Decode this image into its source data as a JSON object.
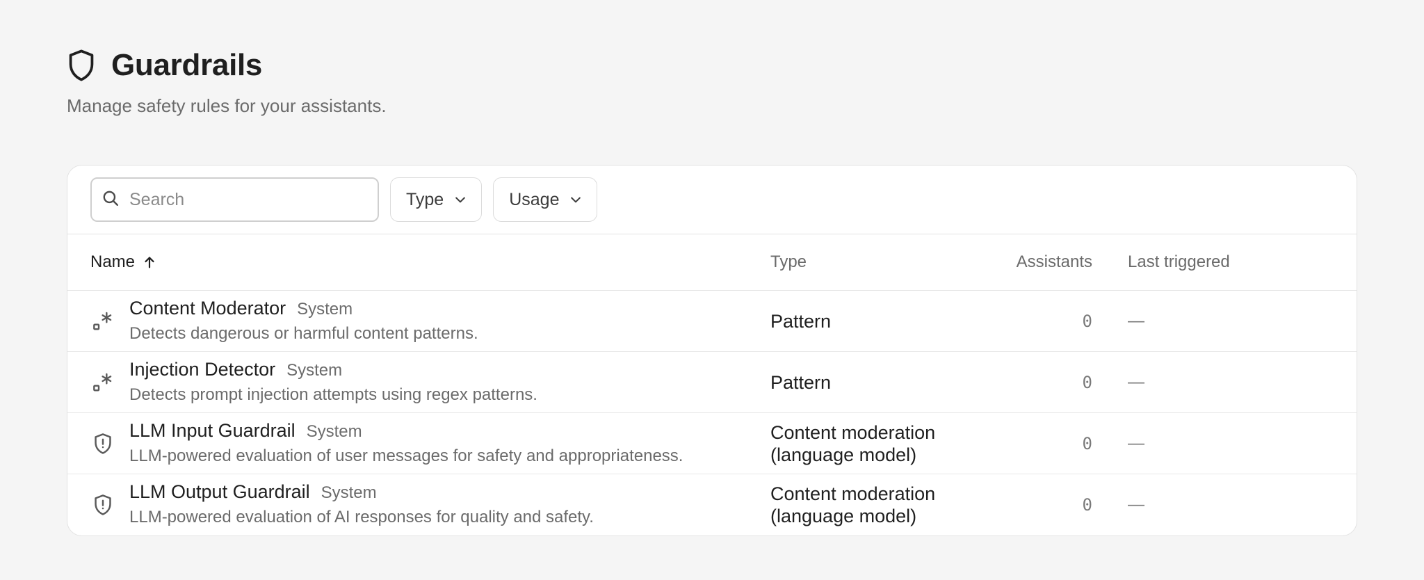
{
  "page": {
    "title": "Guardrails",
    "subtitle": "Manage safety rules for your assistants.",
    "title_icon": "shield-icon"
  },
  "toolbar": {
    "search_placeholder": "Search",
    "filters": [
      {
        "label": "Type",
        "icon": "chevron-down-icon"
      },
      {
        "label": "Usage",
        "icon": "chevron-down-icon"
      }
    ]
  },
  "table": {
    "columns": {
      "name": "Name",
      "type": "Type",
      "assistants": "Assistants",
      "last_triggered": "Last triggered"
    },
    "sort": {
      "column": "Name",
      "direction": "ascending",
      "icon": "arrow-up-icon"
    },
    "rows": [
      {
        "icon": "regex-icon",
        "name": "Content Moderator",
        "badge": "System",
        "description": "Detects dangerous or harmful content patterns.",
        "type_line1": "Pattern",
        "type_line2": "",
        "assistants": "0",
        "last_triggered": "—"
      },
      {
        "icon": "regex-icon",
        "name": "Injection Detector",
        "badge": "System",
        "description": "Detects prompt injection attempts using regex patterns.",
        "type_line1": "Pattern",
        "type_line2": "",
        "assistants": "0",
        "last_triggered": "—"
      },
      {
        "icon": "shield-alert-icon",
        "name": "LLM Input Guardrail",
        "badge": "System",
        "description": "LLM-powered evaluation of user messages for safety and appropriateness.",
        "type_line1": "Content moderation",
        "type_line2": "(language model)",
        "assistants": "0",
        "last_triggered": "—"
      },
      {
        "icon": "shield-alert-icon",
        "name": "LLM Output Guardrail",
        "badge": "System",
        "description": "LLM-powered evaluation of AI responses for quality and safety.",
        "type_line1": "Content moderation",
        "type_line2": "(language model)",
        "assistants": "0",
        "last_triggered": "—"
      }
    ]
  }
}
